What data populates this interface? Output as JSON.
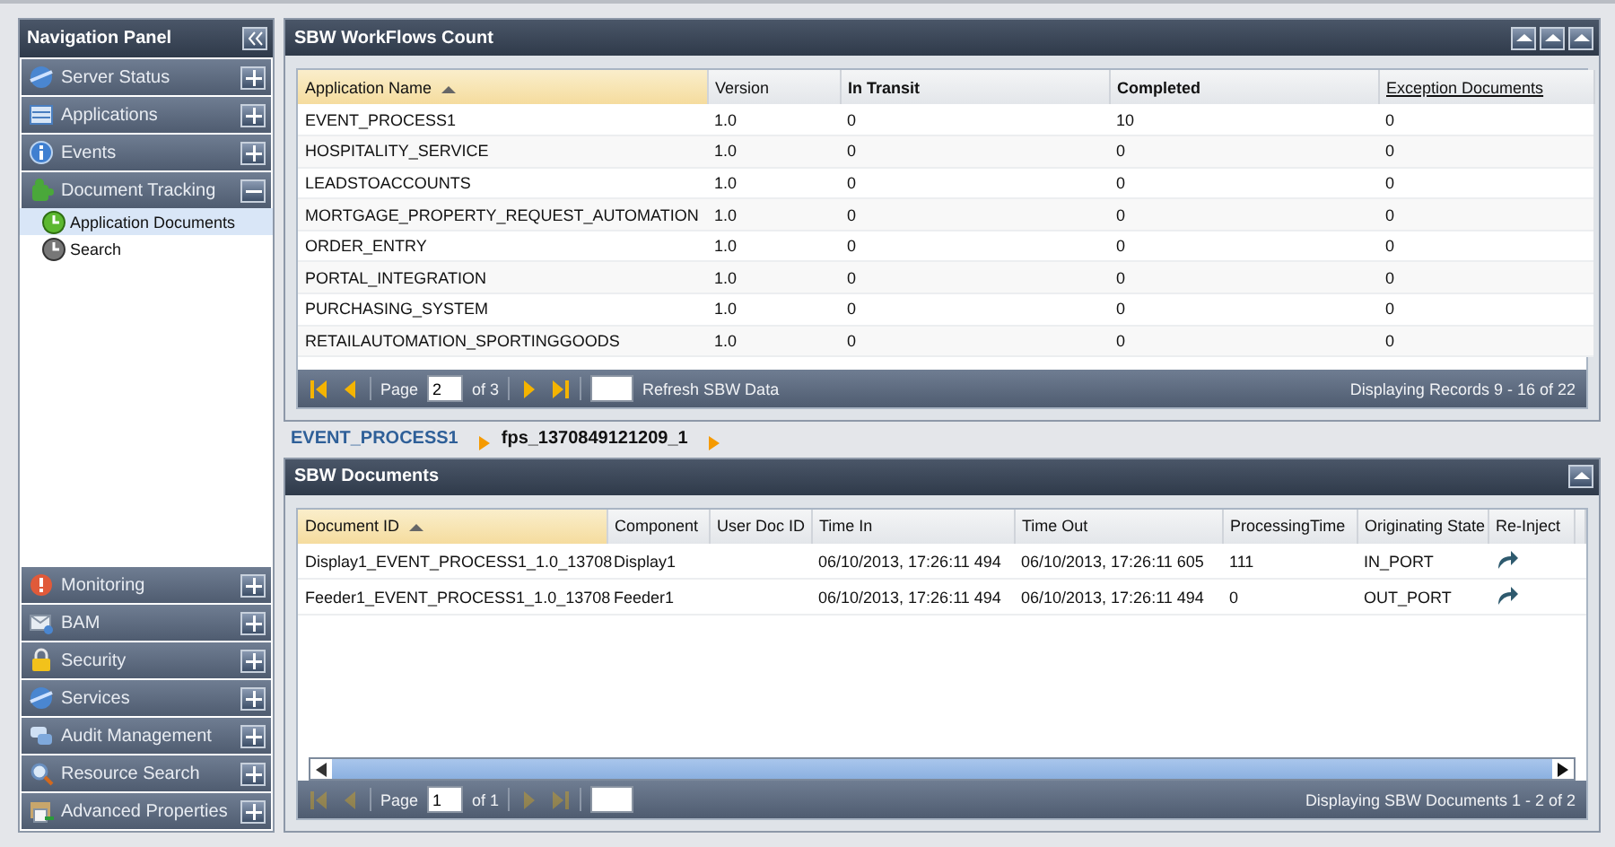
{
  "nav": {
    "title": "Navigation Panel",
    "top_sections": [
      {
        "label": "Server Status",
        "expanded": false
      },
      {
        "label": "Applications",
        "expanded": false
      },
      {
        "label": "Events",
        "expanded": false
      },
      {
        "label": "Document Tracking",
        "expanded": true,
        "children": [
          {
            "label": "Application Documents",
            "selected": true
          },
          {
            "label": "Search",
            "selected": false
          }
        ]
      }
    ],
    "bottom_sections": [
      {
        "label": "Monitoring",
        "expanded": false
      },
      {
        "label": "BAM",
        "expanded": false
      },
      {
        "label": "Security",
        "expanded": false
      },
      {
        "label": "Services",
        "expanded": false
      },
      {
        "label": "Audit Management",
        "expanded": false
      },
      {
        "label": "Resource Search",
        "expanded": false
      },
      {
        "label": "Advanced Properties",
        "expanded": false
      }
    ]
  },
  "workflows": {
    "title": "SBW WorkFlows Count",
    "columns": [
      {
        "label": "Application Name",
        "kind": "sorted"
      },
      {
        "label": "Version",
        "kind": "plain"
      },
      {
        "label": "In Transit",
        "kind": "bold"
      },
      {
        "label": "Completed",
        "kind": "bold"
      },
      {
        "label": "Exception Documents",
        "kind": "link"
      }
    ],
    "rows": [
      [
        "EVENT_PROCESS1",
        "1.0",
        "0",
        "10",
        "0"
      ],
      [
        "HOSPITALITY_SERVICE",
        "1.0",
        "0",
        "0",
        "0"
      ],
      [
        "LEADSTOACCOUNTS",
        "1.0",
        "0",
        "0",
        "0"
      ],
      [
        "MORTGAGE_PROPERTY_REQUEST_AUTOMATION",
        "1.0",
        "0",
        "0",
        "0"
      ],
      [
        "ORDER_ENTRY",
        "1.0",
        "0",
        "0",
        "0"
      ],
      [
        "PORTAL_INTEGRATION",
        "1.0",
        "0",
        "0",
        "0"
      ],
      [
        "PURCHASING_SYSTEM",
        "1.0",
        "0",
        "0",
        "0"
      ],
      [
        "RETAILAUTOMATION_SPORTINGGOODS",
        "1.0",
        "0",
        "0",
        "0"
      ]
    ],
    "pager": {
      "nav_disabled": false,
      "page_label": "Page",
      "page": "2",
      "of": "of 3",
      "refresh": "Refresh SBW Data",
      "display": "Displaying Records 9 - 16 of 22"
    }
  },
  "breadcrumb": [
    {
      "label": "EVENT_PROCESS1",
      "kind": "link"
    },
    {
      "label": "fps_1370849121209_1",
      "kind": "current"
    }
  ],
  "documents": {
    "title": "SBW Documents",
    "columns": [
      {
        "label": "Document ID",
        "kind": "sorted"
      },
      {
        "label": "Component",
        "kind": "plain"
      },
      {
        "label": "User Doc ID",
        "kind": "plain"
      },
      {
        "label": "Time In",
        "kind": "plain"
      },
      {
        "label": "Time Out",
        "kind": "plain"
      },
      {
        "label": "ProcessingTime",
        "kind": "plain"
      },
      {
        "label": "Originating State",
        "kind": "plain"
      },
      {
        "label": "Re-Inject",
        "kind": "plain"
      }
    ],
    "rows": [
      [
        "Display1_EVENT_PROCESS1_1.0_13708",
        "Display1",
        "",
        "06/10/2013, 17:26:11 494",
        "06/10/2013, 17:26:11 605",
        "111",
        "IN_PORT"
      ],
      [
        "Feeder1_EVENT_PROCESS1_1.0_13708",
        "Feeder1",
        "",
        "06/10/2013, 17:26:11 494",
        "06/10/2013, 17:26:11 494",
        "0",
        "OUT_PORT"
      ]
    ],
    "pager": {
      "nav_disabled": true,
      "page_label": "Page",
      "page": "1",
      "of": "of 1",
      "display": "Displaying SBW Documents 1 - 2 of 2"
    }
  }
}
